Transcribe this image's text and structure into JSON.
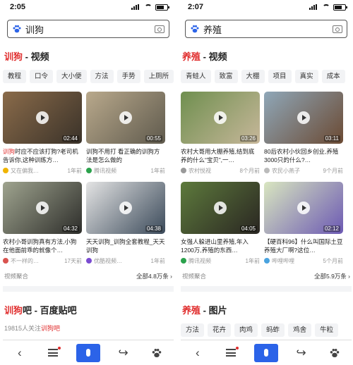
{
  "left": {
    "status_time": "2:05",
    "search_query": "训狗",
    "section_keyword": "训狗",
    "section_suffix": " - 视频",
    "chips": [
      "教程",
      "口令",
      "大小便",
      "方法",
      "手势",
      "上厕所"
    ],
    "videos": [
      {
        "duration": "02:44",
        "title_hl": "训狗",
        "title_rest": "时应不应该打狗?老司机告诉你,这种训练方…",
        "source": "又在偏我…",
        "time": "1年前",
        "thumb_color": "#8a6b4a",
        "thumb_color2": "#3a3229"
      },
      {
        "duration": "00:55",
        "title_hl": "",
        "title_rest": "不用打 看正确的训狗方法是怎么做的",
        "source": "腾讯视频",
        "time": "1年前",
        "thumb_color": "#b9a98c",
        "thumb_color2": "#5f5a4d"
      },
      {
        "duration": "04:32",
        "title_hl": "",
        "title_rest": "农村小哥训狗真有方法,小狗在他面前乖的就像个…",
        "source": "不一样的…",
        "time": "17天前",
        "thumb_color": "#9fa48f",
        "thumb_color2": "#2d2d2a"
      },
      {
        "duration": "04:38",
        "title_hl": "",
        "title_rest": "天天训狗_训狗全套教程_天天训狗",
        "source": "优酷视频…",
        "time": "1年前",
        "thumb_color": "#e4e4e4",
        "thumb_color2": "#3b4a5a"
      }
    ],
    "footer_left": "视频聚合",
    "footer_right": "全部4.8万条 ›",
    "sec2_keyword": "训狗",
    "sec2_suffix": "吧 - 百度贴吧",
    "subinfo_prefix": "19815人关注",
    "subinfo_keyword": "训狗吧"
  },
  "right": {
    "status_time": "2:07",
    "search_query": "养殖",
    "section_keyword": "养殖",
    "section_suffix": " - 视频",
    "chips": [
      "青蛙人",
      "致富",
      "大棚",
      "项目",
      "真实",
      "成本"
    ],
    "videos": [
      {
        "duration": "03:26",
        "title_hl": "",
        "title_rest": "农村大哥用大棚养殖,结到底养的什么“宝贝”,一…",
        "source": "农村悦视",
        "time": "8个月前",
        "thumb_color": "#6f8f4f",
        "thumb_color2": "#c7b79a"
      },
      {
        "duration": "03:11",
        "title_hl": "",
        "title_rest": "80后农村小伙回乡创业,养殖3000只的什么?…",
        "source": "农民小燕子",
        "time": "9个月前",
        "thumb_color": "#8fa7b8",
        "thumb_color2": "#6b4a33"
      },
      {
        "duration": "04:05",
        "title_hl": "",
        "title_rest": "女强人躲进山里养殖,年入1200万,养殖的东西…",
        "source": "腾讯视频",
        "time": "1年前",
        "thumb_color": "#5d7a3c",
        "thumb_color2": "#2a2622"
      },
      {
        "duration": "02:12",
        "title_hl": "",
        "title_rest": "【硬百科96】什么叫国际土豆养殖大厂啊?这位…",
        "source": "哔哩哔哩",
        "time": "5个月前",
        "thumb_color": "#d9e6c0",
        "thumb_color2": "#6c59b3"
      }
    ],
    "footer_left": "视频聚合",
    "footer_right": "全部5.9万条 ›",
    "sec2_keyword": "养殖",
    "sec2_suffix": " - 图片",
    "chips2": [
      "方法",
      "花卉",
      "肉鸡",
      "蚂蚱",
      "鸡舍",
      "牛粒"
    ]
  },
  "colors": {
    "highlight": "#e02d2d",
    "mic_blue": "#2b63e8"
  },
  "icons": {
    "back": "back-arrow-icon",
    "menu": "menu-icon",
    "mic": "microphone-icon",
    "share": "share-icon",
    "paw": "paw-icon",
    "camera": "camera-icon"
  }
}
